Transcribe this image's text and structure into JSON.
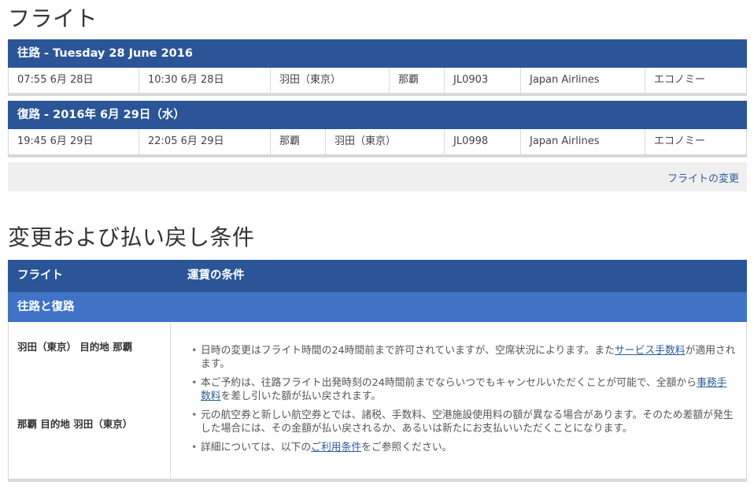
{
  "flights_title": "フライト",
  "outbound": {
    "header": "往路 - Tuesday 28 June 2016",
    "depart": "07:55 6月 28日",
    "arrive": "10:30 6月 28日",
    "from": "羽田（東京）",
    "to": "那覇",
    "flight_no": "JL0903",
    "airline": "Japan Airlines",
    "cabin": "エコノミー"
  },
  "inbound": {
    "header": "復路 - 2016年 6月 29日（水）",
    "depart": "19:45 6月 29日",
    "arrive": "22:05 6月 29日",
    "from": "那覇",
    "to": "羽田（東京）",
    "flight_no": "JL0998",
    "airline": "Japan Airlines",
    "cabin": "エコノミー"
  },
  "change_flight_link": "フライトの変更",
  "conditions_title": "変更および払い戻し条件",
  "conditions_table": {
    "col_flight": "フライト",
    "col_fare": "運賃の条件",
    "subhead": "往路と復路",
    "route1": "羽田（東京） 目的地 那覇",
    "route2": "那覇 目的地 羽田（東京）",
    "terms": {
      "t1_pre": "日時の変更はフライト時間の24時間前まで許可されていますが、空席状況によります。また",
      "t1_link": "サービス手数料",
      "t1_post": "が適用されます。",
      "t2_pre": "本ご予約は、往路フライト出発時刻の24時間前までならいつでもキャンセルいただくことが可能で、全額から",
      "t2_link": "事務手数料",
      "t2_post": "を差し引いた額が払い戻されます。",
      "t3": "元の航空券と新しい航空券とでは、諸税、手数料、空港施設使用料の額が異なる場合があります。そのため差額が発生した場合には、その金額が払い戻されるか、あるいは新たにお支払いいただくことになります。",
      "t4_pre": "詳細については、以下の",
      "t4_link": "ご利用条件",
      "t4_post": "をご参照ください。"
    }
  },
  "colors": {
    "header_blue": "#2b5597",
    "subheader_blue": "#3e73c6",
    "link_blue": "#2c5d99"
  }
}
